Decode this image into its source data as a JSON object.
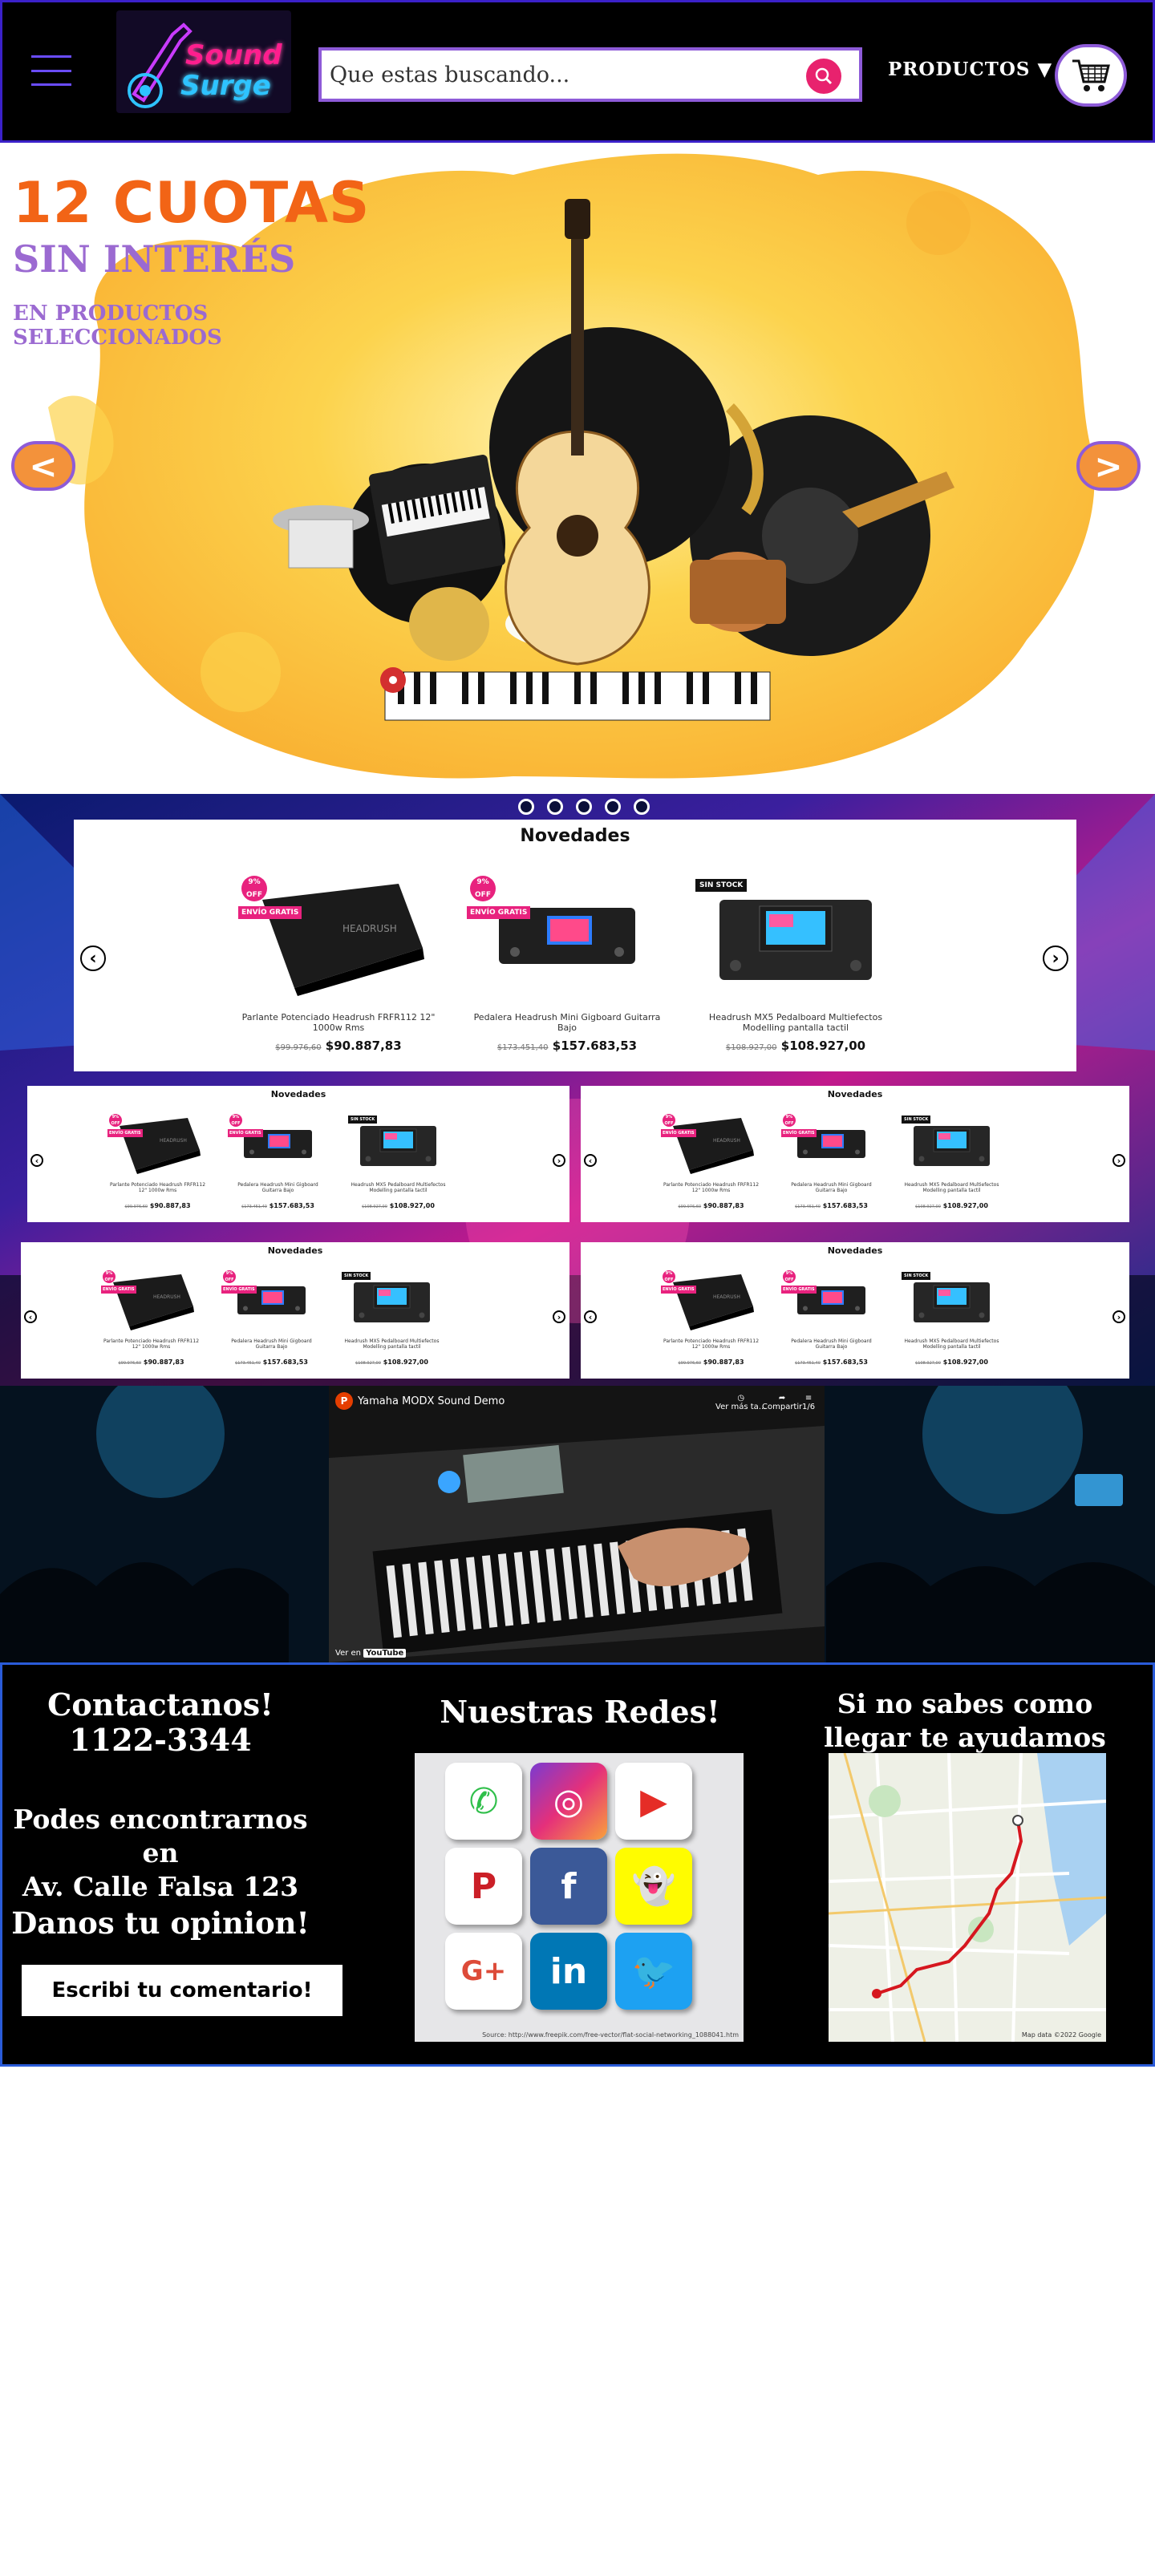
{
  "header": {
    "logo_line1": "Sound",
    "logo_line2": "Surge",
    "search_placeholder": "Que estas buscando...",
    "productos_label": "PRODUCTOS ▼"
  },
  "hero": {
    "promo_line1": "12 CUOTAS",
    "promo_line2": "SIN INTERÉS",
    "promo_line3": "EN PRODUCTOS SELECCIONADOS",
    "prev_label": "<",
    "next_label": ">"
  },
  "novedades": {
    "title": "Novedades",
    "prev_label": "‹",
    "next_label": "›",
    "products": [
      {
        "name": "Parlante Potenciado Headrush FRFR112 12\" 1000w Rms",
        "old_price": "$99.976,60",
        "price": "$90.887,83",
        "badge_discount": "9% OFF",
        "badge_shipping": "ENVÍO GRATIS"
      },
      {
        "name": "Pedalera Headrush Mini Gigboard Guitarra Bajo",
        "old_price": "$173.451,40",
        "price": "$157.683,53",
        "badge_discount": "9% OFF",
        "badge_shipping": "ENVÍO GRATIS"
      },
      {
        "name": "Headrush MX5 Pedalboard Multiefectos Modelling pantalla tactil",
        "old_price": "$108.927,00",
        "price": "$108.927,00",
        "badge_status": "SIN STOCK"
      }
    ]
  },
  "video": {
    "title": "Yamaha MODX Sound Demo",
    "channel_initial": "P",
    "watch_later": "Ver más ta...",
    "share": "Compartir",
    "position": "1/6",
    "watch_on": "Ver en",
    "youtube": "YouTube"
  },
  "footer": {
    "contact_title": "Contactanos!",
    "phone": "1122-3344",
    "address_line1": "Podes encontrarnos en",
    "address_line2": "Av. Calle Falsa 123",
    "opinion_title": "Danos tu opinion!",
    "comment_button": "Escribi tu comentario!",
    "redes_title": "Nuestras Redes!",
    "social_source": "Source: http://www.freepik.com/free-vector/flat-social-networking_1088041.htm",
    "map_title": "Si no sabes como llegar te ayudamos",
    "map_credit": "Map data ©2022 Google"
  },
  "colors": {
    "accent_purple": "#8e5bd8",
    "promo_orange": "#f26416",
    "pink": "#e8226e"
  }
}
